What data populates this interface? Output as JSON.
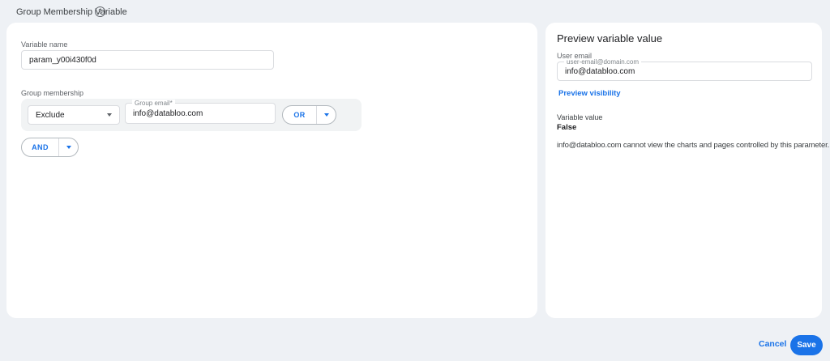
{
  "header": {
    "title": "Group Membership Variable",
    "help_icon_glyph": "?"
  },
  "left_panel": {
    "variable_name_label": "Variable name",
    "variable_name_value": "param_y00i430f0d",
    "group_membership_label": "Group membership",
    "condition": {
      "operator": "Exclude",
      "group_email_label": "Group email*",
      "group_email_value": "info@databloo.com",
      "or_button": "OR"
    },
    "and_button": "AND"
  },
  "right_panel": {
    "title": "Preview variable value",
    "user_email_label": "User email",
    "user_email_placeholder_label": "user-email@domain.com",
    "user_email_value": "info@databloo.com",
    "preview_visibility_link": "Preview visibility",
    "variable_value_label": "Variable value",
    "variable_value": "False",
    "description": "info@databloo.com cannot view the charts and pages controlled by this parameter."
  },
  "footer": {
    "cancel": "Cancel",
    "save": "Save"
  },
  "colors": {
    "accent": "#1a73e8",
    "background": "#eef1f5",
    "card": "#ffffff",
    "condition_row_bg": "#f1f3f4"
  }
}
